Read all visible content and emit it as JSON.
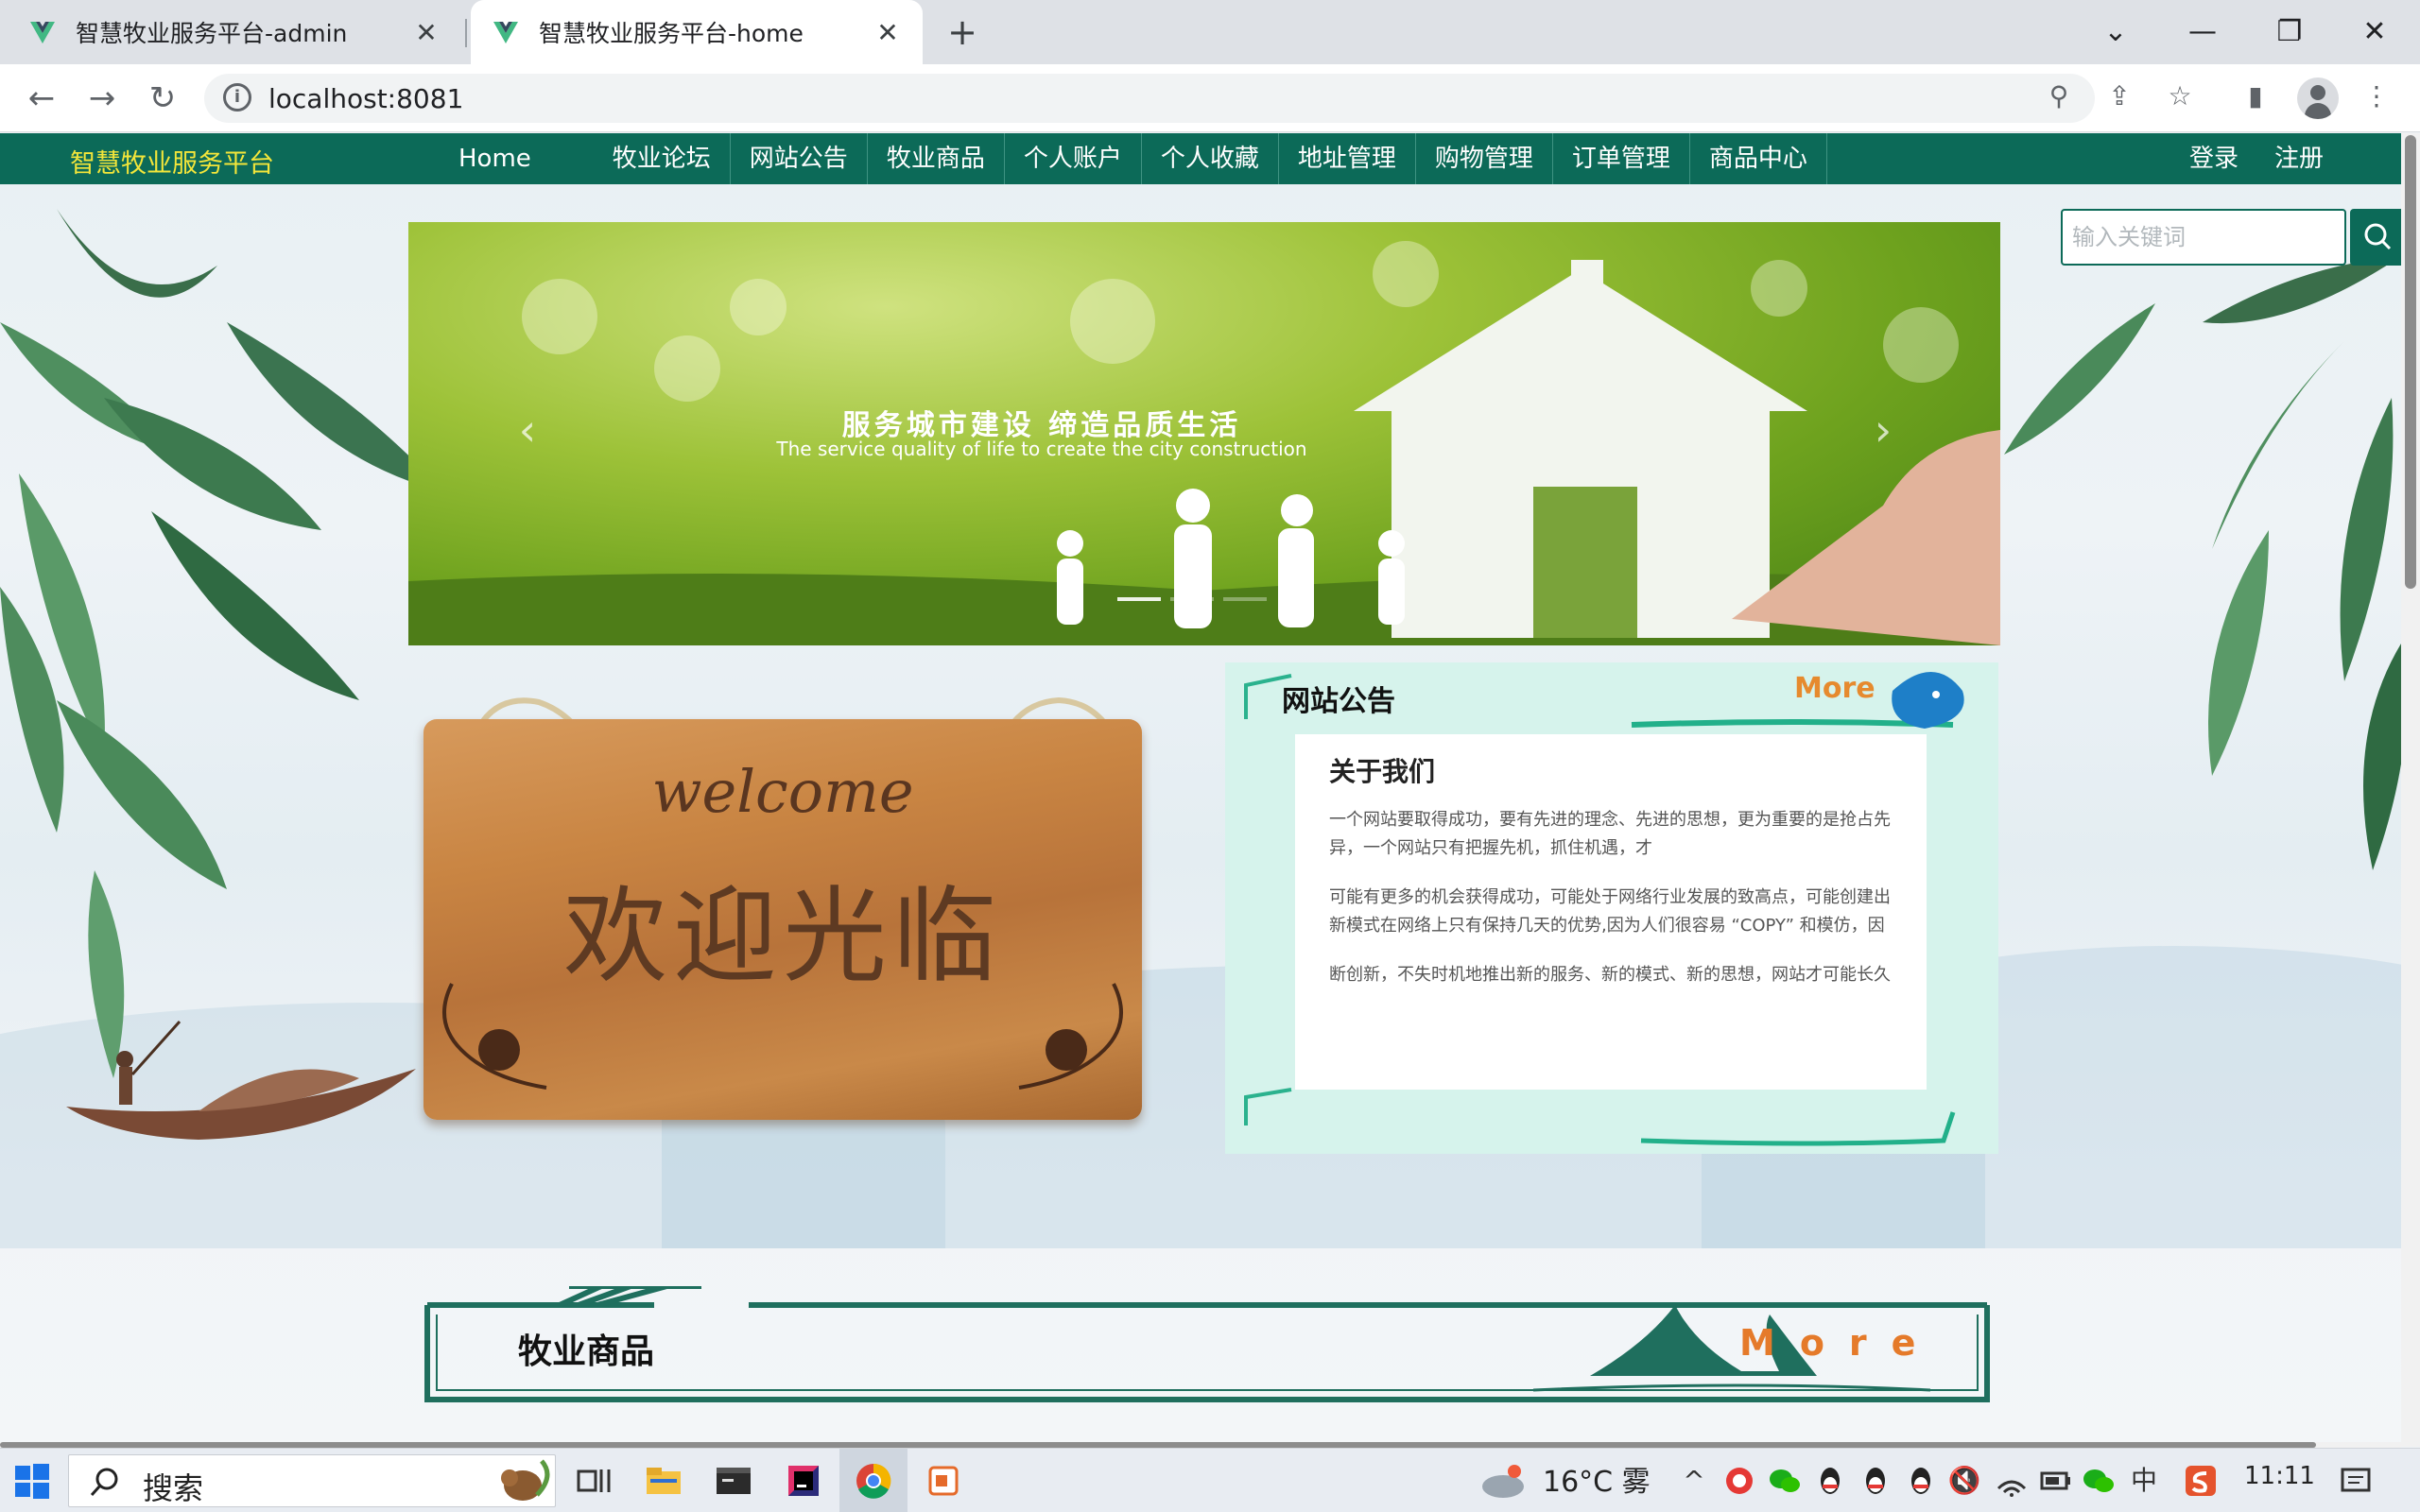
{
  "browser": {
    "tabs": [
      {
        "title": "智慧牧业服务平台-admin",
        "active": false
      },
      {
        "title": "智慧牧业服务平台-home",
        "active": true
      }
    ],
    "url": "localhost:8081",
    "new_tab": "+",
    "tab_close": "✕",
    "window_controls": {
      "dropdown": "⌄",
      "minimize": "—",
      "restore": "❐",
      "close": "✕"
    }
  },
  "site": {
    "brand": "智慧牧业服务平台",
    "nav": [
      {
        "label": "Home"
      },
      {
        "label": "牧业论坛"
      },
      {
        "label": "网站公告"
      },
      {
        "label": "牧业商品"
      },
      {
        "label": "个人账户"
      },
      {
        "label": "个人收藏"
      },
      {
        "label": "地址管理"
      },
      {
        "label": "购物管理"
      },
      {
        "label": "订单管理"
      },
      {
        "label": "商品中心"
      }
    ],
    "login": "登录",
    "register": "注册",
    "search_placeholder": "输入关键词"
  },
  "carousel": {
    "title": "服务城市建设  缔造品质生活",
    "subtitle": "The service quality of life to create the city construction",
    "prev": "‹",
    "next": "›",
    "active_index": 0,
    "count": 3
  },
  "welcome": {
    "en": "welcome",
    "zh": "欢迎光临"
  },
  "notice": {
    "title": "网站公告",
    "more": "More",
    "article_title": "关于我们",
    "paragraphs": [
      [
        "一个网站要取得成功，要有先进的理念、先进的思想，更为重要的是抢占先",
        "异，一个网站只有把握先机，抓住机遇，才"
      ],
      [
        "可能有更多的机会获得成功，可能处于网络行业发展的致高点，可能创建出",
        "新模式在网络上只有保持几天的优势,因为人们很容易 “COPY” 和模仿，因"
      ],
      [
        "断创新，不失时机地推出新的服务、新的模式、新的思想，网站才可能长久"
      ]
    ]
  },
  "products": {
    "title": "牧业商品",
    "more": "More"
  },
  "taskbar": {
    "search_label": "搜索",
    "weather": "16°C 雾",
    "ime": "中",
    "clock": "11:11"
  },
  "colors": {
    "nav_bg": "#0c6a58",
    "brand": "#f3e63a",
    "more": "#e68a2e",
    "panel": "#d6f3ec"
  }
}
